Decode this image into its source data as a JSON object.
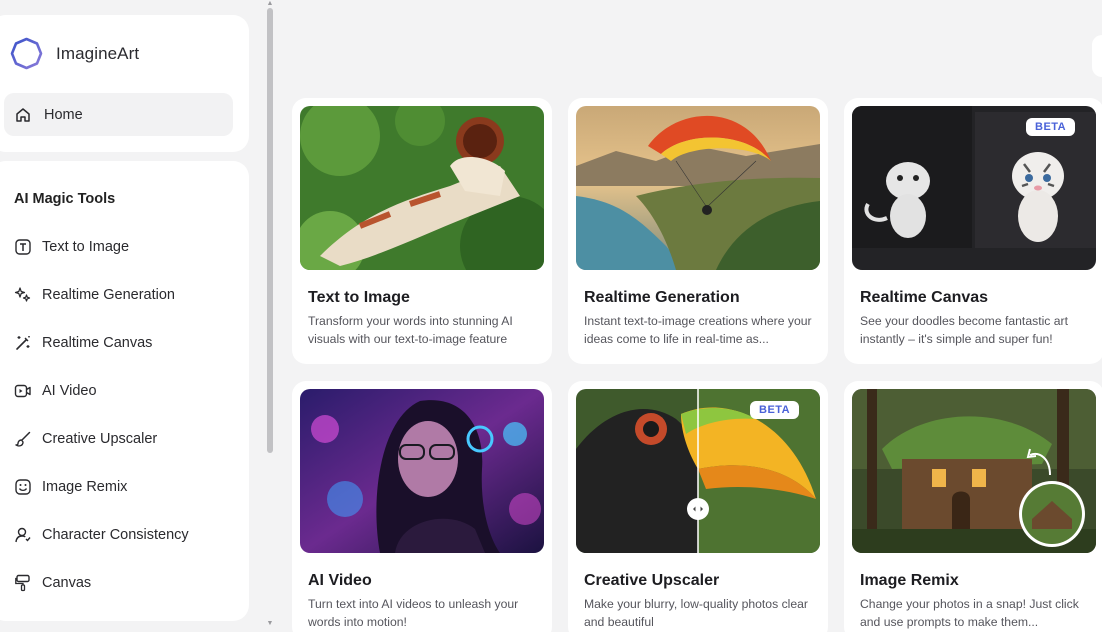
{
  "brand": {
    "name": "ImagineArt",
    "logo_icon": "ring-logo-icon"
  },
  "sidebar": {
    "home": {
      "label": "Home",
      "icon": "home-icon"
    },
    "section_title": "AI Magic Tools",
    "items": [
      {
        "label": "Text to Image",
        "icon": "text-t-icon"
      },
      {
        "label": "Realtime Generation",
        "icon": "sparkles-icon"
      },
      {
        "label": "Realtime Canvas",
        "icon": "magic-wand-icon"
      },
      {
        "label": "AI Video",
        "icon": "video-icon"
      },
      {
        "label": "Creative Upscaler",
        "icon": "brush-icon"
      },
      {
        "label": "Image Remix",
        "icon": "image-face-icon"
      },
      {
        "label": "Character Consistency",
        "icon": "character-icon"
      },
      {
        "label": "Canvas",
        "icon": "paint-roller-icon"
      }
    ]
  },
  "cards": [
    {
      "title": "Text to Image",
      "desc": "Transform your words into stunning AI visuals with our text-to-image feature",
      "badge": ""
    },
    {
      "title": "Realtime Generation",
      "desc": "Instant text-to-image creations where your ideas come to life in real-time as...",
      "badge": ""
    },
    {
      "title": "Realtime Canvas",
      "desc": "See your doodles become fantastic art instantly – it's simple and super fun!",
      "badge": "BETA"
    },
    {
      "title": "AI Video",
      "desc": "Turn text into AI videos to unleash your words into motion!",
      "badge": ""
    },
    {
      "title": "Creative Upscaler",
      "desc": "Make your blurry, low-quality photos clear and beautiful",
      "badge": "BETA"
    },
    {
      "title": "Image Remix",
      "desc": "Change your photos in a snap! Just click and use prompts to make them...",
      "badge": ""
    }
  ],
  "colors": {
    "accent": "#4a62d8",
    "background": "#f3f3f4",
    "card": "#ffffff"
  }
}
